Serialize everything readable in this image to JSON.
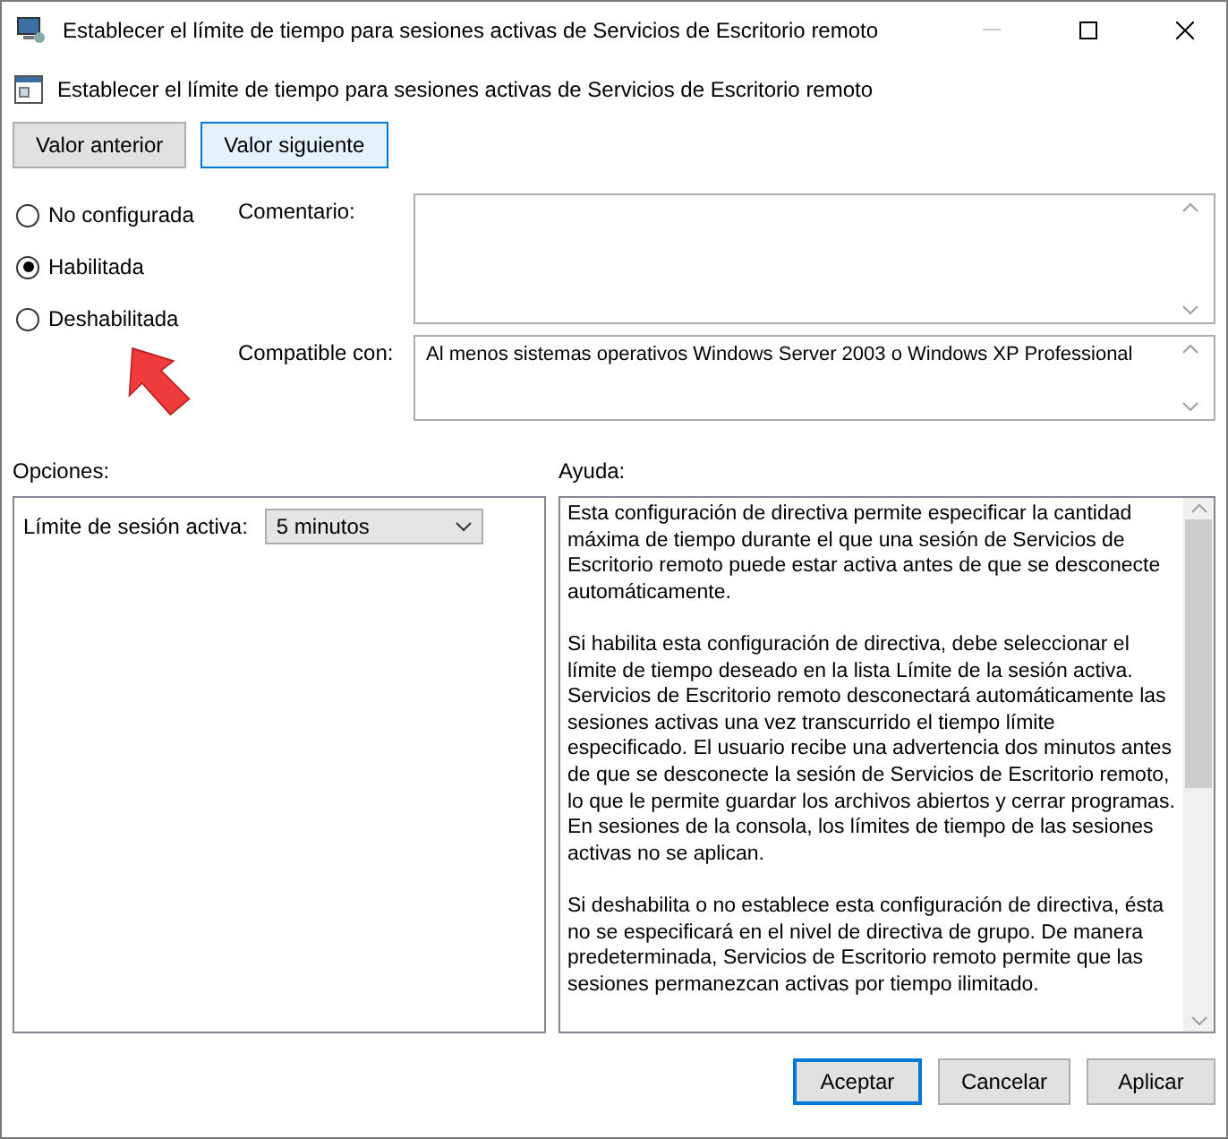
{
  "window": {
    "title": "Establecer el límite de tiempo para sesiones activas de Servicios de Escritorio remoto"
  },
  "header": {
    "title": "Establecer el límite de tiempo para sesiones activas de Servicios de Escritorio remoto"
  },
  "nav_buttons": [
    {
      "label": "Valor anterior",
      "highlighted": false
    },
    {
      "label": "Valor siguiente",
      "highlighted": true
    }
  ],
  "state_options": [
    {
      "label": "No configurada",
      "selected": false
    },
    {
      "label": "Habilitada",
      "selected": true
    },
    {
      "label": "Deshabilitada",
      "selected": false
    }
  ],
  "comment": {
    "label": "Comentario:"
  },
  "compatible": {
    "label": "Compatible con:",
    "value": "Al menos sistemas operativos Windows Server 2003 o Windows XP Professional"
  },
  "options": {
    "heading": "Opciones:",
    "field_label": "Límite de sesión activa:",
    "field_value": "5 minutos"
  },
  "help": {
    "heading": "Ayuda:",
    "paragraphs": [
      "Esta configuración de directiva permite especificar la cantidad máxima de tiempo durante el que una sesión de Servicios de Escritorio remoto puede estar activa antes de que se desconecte automáticamente.",
      "Si habilita esta configuración de directiva, debe seleccionar el límite de tiempo deseado en la lista Límite de la sesión activa. Servicios de Escritorio remoto desconectará automáticamente las sesiones activas una vez transcurrido el tiempo límite especificado. El usuario recibe una advertencia dos minutos antes de que se desconecte la sesión de Servicios de Escritorio remoto, lo que le permite guardar los archivos abiertos y cerrar programas. En sesiones de la consola, los límites de tiempo de las sesiones activas no se aplican.",
      "Si deshabilita o no establece esta configuración de directiva, ésta no se especificará en el nivel de directiva de grupo. De manera predeterminada, Servicios de Escritorio remoto permite que las sesiones permanezcan activas por tiempo ilimitado."
    ]
  },
  "buttons": [
    {
      "label": "Aceptar",
      "default": true
    },
    {
      "label": "Cancelar",
      "default": false
    },
    {
      "label": "Aplicar",
      "default": false
    }
  ]
}
